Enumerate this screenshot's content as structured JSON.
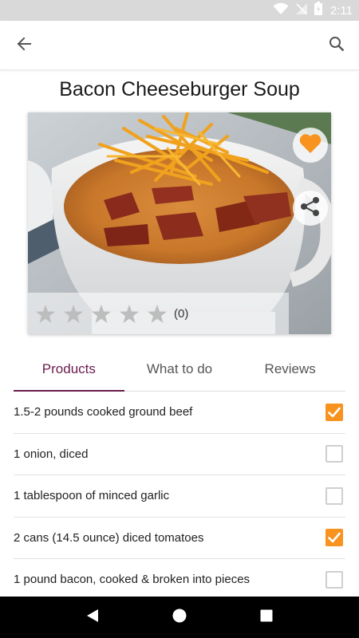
{
  "status_bar": {
    "time": "2:11",
    "icons": [
      "wifi-icon",
      "signal-off-icon",
      "battery-icon"
    ]
  },
  "app_bar": {
    "back_icon": "arrow-back-icon",
    "search_icon": "search-icon"
  },
  "recipe": {
    "title": "Bacon Cheeseburger Soup",
    "rating_value": 0,
    "rating_max": 5,
    "rating_count": "(0)",
    "favorite_icon": "heart-icon",
    "share_icon": "share-icon"
  },
  "tabs": [
    {
      "label": "Products",
      "active": true
    },
    {
      "label": "What to do",
      "active": false
    },
    {
      "label": "Reviews",
      "active": false
    }
  ],
  "ingredients": [
    {
      "text": "1.5-2 pounds cooked ground beef",
      "checked": true
    },
    {
      "text": "1 onion, diced",
      "checked": false
    },
    {
      "text": "1 tablespoon of minced garlic",
      "checked": false
    },
    {
      "text": "2 cans (14.5 ounce) diced tomatoes",
      "checked": true
    },
    {
      "text": "1 pound bacon, cooked & broken into pieces",
      "checked": false
    }
  ],
  "nav_bar": {
    "icons": [
      "back-triangle-icon",
      "home-circle-icon",
      "recents-square-icon"
    ]
  },
  "colors": {
    "accent": "#f7931e",
    "tab_active": "#6a1b4d",
    "status_bar": "#d9d9d9"
  }
}
